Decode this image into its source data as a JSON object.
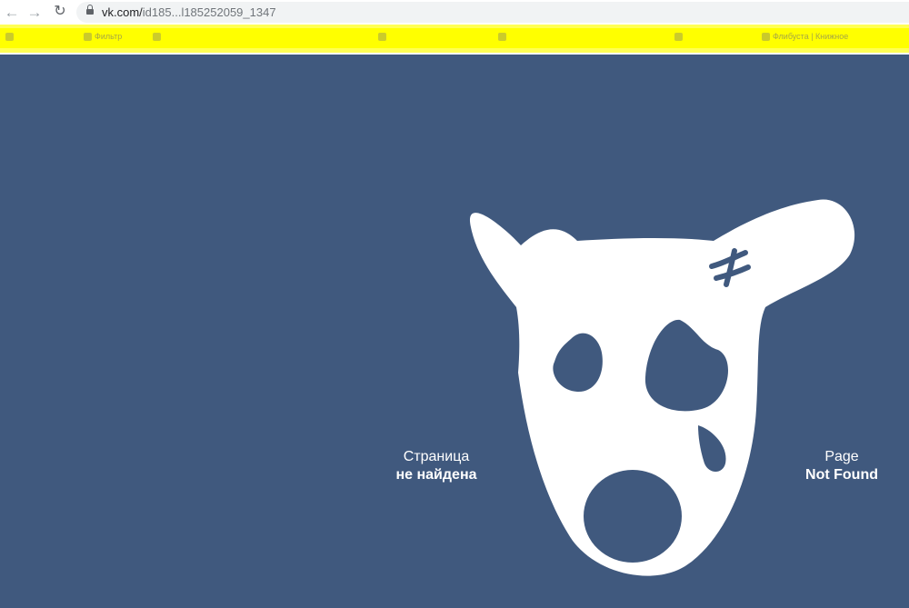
{
  "browser": {
    "url_host": "vk.com/",
    "url_path": "id185...l185252059_1347"
  },
  "bookmarks_bar": {
    "items": [
      "",
      "Фильтр",
      "",
      "",
      "",
      "",
      "Флибуста | Книжное"
    ]
  },
  "error": {
    "ru_line1": "Страница",
    "ru_line2": "не найдена",
    "en_line1": "Page",
    "en_line2": "Not Found"
  },
  "colors": {
    "background": "#40597e",
    "mascot": "#ffffff",
    "highlight": "#ffff00"
  }
}
